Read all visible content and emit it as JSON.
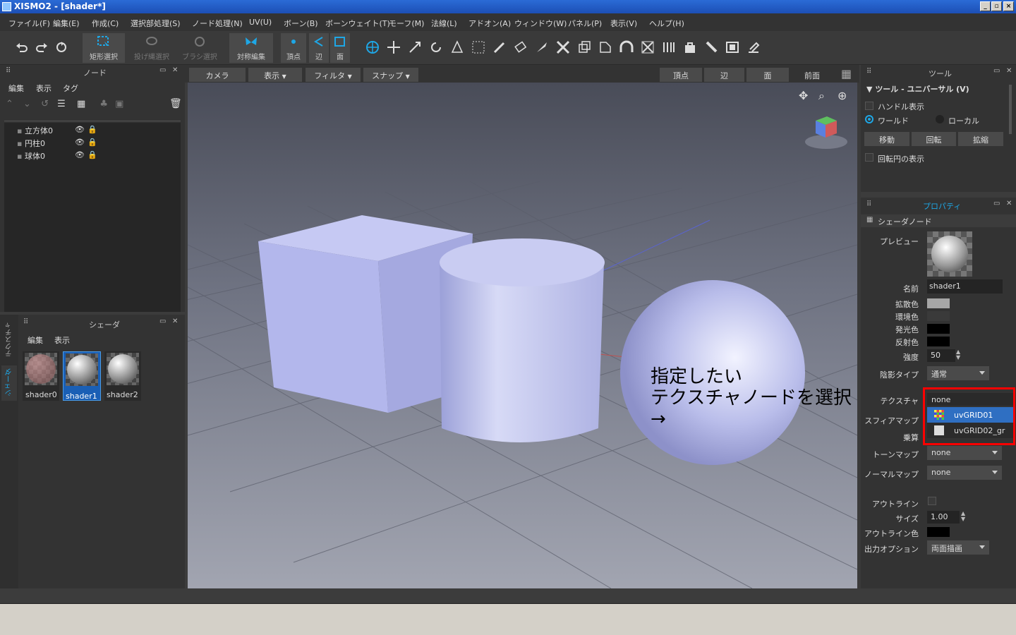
{
  "title": "XISMO2 - [shader*]",
  "menu": [
    "ファイル(F)",
    "編集(E)",
    "作成(C)",
    "選択部処理(S)",
    "ノード処理(N)",
    "UV(U)",
    "ボーン(B)",
    "ボーンウェイト(T)",
    "モーフ(M)",
    "法線(L)",
    "アドオン(A)",
    "ウィンドウ(W)",
    "パネル(P)",
    "表示(V)",
    "ヘルプ(H)"
  ],
  "toolbar": {
    "rect_select": "矩形選択",
    "lasso_select": "投げ縄選択",
    "brush_select": "ブラシ選択",
    "sym_edit": "対称編集",
    "vertex": "頂点",
    "edge": "辺",
    "face": "面"
  },
  "node_panel": {
    "title": "ノード",
    "menu_edit": "編集",
    "menu_view": "表示",
    "menu_tag": "タグ",
    "items": [
      "立方体0",
      "円柱0",
      "球体0"
    ]
  },
  "shader_panel": {
    "title": "シェーダ",
    "menu_edit": "編集",
    "menu_view": "表示",
    "side_tab_texture": "テクスチャ",
    "side_tab_shader": "シェーダ",
    "shaders": [
      "shader0",
      "shader1",
      "shader2"
    ],
    "selected": "shader1"
  },
  "viewport": {
    "camera": "カメラ",
    "view": "表示",
    "filter": "フィルタ",
    "snap": "スナップ",
    "vertex": "頂点",
    "edge": "辺",
    "face": "面",
    "front": "前面",
    "annotation_line1": "指定したい",
    "annotation_line2": "テクスチャノードを選択→"
  },
  "tool_panel": {
    "title": "ツール",
    "section": "ツール - ユニバーサル (V)",
    "handle_display": "ハンドル表示",
    "world": "ワールド",
    "local": "ローカル",
    "move": "移動",
    "rotate": "回転",
    "scale": "拡縮",
    "rot_circle": "回転円の表示"
  },
  "properties": {
    "title": "プロパティ",
    "section": "シェーダノード",
    "preview_label": "プレビュー",
    "name_label": "名前",
    "name_value": "shader1",
    "diffuse_label": "拡散色",
    "ambient_label": "環境色",
    "emissive_label": "発光色",
    "specular_label": "反射色",
    "power_label": "強度",
    "power_value": "50",
    "shading_label": "陰影タイプ",
    "shading_value": "通常",
    "texture_label": "テクスチャ",
    "texture_value": "none",
    "texture_options": [
      "uvGRID01",
      "uvGRID02_gr"
    ],
    "sphere_label": "スフィアマップ",
    "multiply_label": "乗算",
    "toon_label": "トーンマップ",
    "toon_value": "none",
    "normal_label": "ノーマルマップ",
    "normal_value": "none",
    "outline_label": "アウトライン",
    "size_label": "サイズ",
    "size_value": "1.00",
    "outline_color_label": "アウトライン色",
    "output_label": "出力オプション",
    "output_value": "両面描画"
  },
  "colors": {
    "accent": "#1ea7e6",
    "selection": "#2f6fc2",
    "highlight_box": "#ff0000",
    "object": "#b9bdea"
  }
}
